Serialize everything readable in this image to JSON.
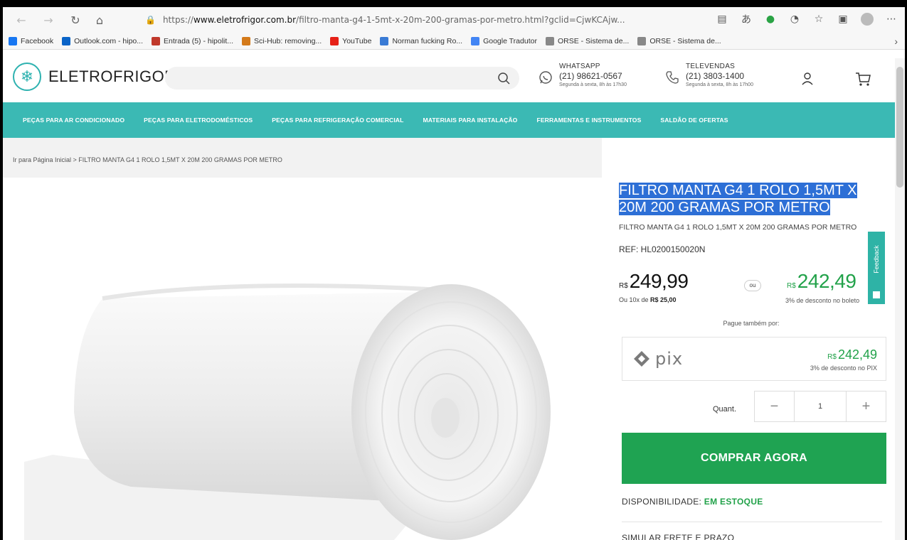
{
  "browser": {
    "url_prefix": "https://",
    "url_host": "www.eletrofrigor.com.br",
    "url_path": "/filtro-manta-g4-1-5mt-x-20m-200-gramas-por-metro.html?gclid=CjwKCAjw...",
    "bookmarks": [
      "Facebook",
      "Outlook.com - hipo...",
      "Entrada (5) - hipolit...",
      "Sci-Hub: removing...",
      "YouTube",
      "Norman fucking Ro...",
      "Google Tradutor",
      "ORSE - Sistema de...",
      "ORSE - Sistema de..."
    ],
    "bookmark_colors": [
      "#1877f2",
      "#0a64c8",
      "#c0392b",
      "#d47a1a",
      "#e62117",
      "#3a7bd5",
      "#4285f4",
      "#888888",
      "#888888"
    ]
  },
  "header": {
    "logo_text": "ELETROFRIGOR",
    "whatsapp": {
      "title": "WHATSAPP",
      "phone": "(21) 98621-0567",
      "hours": "Segunda à sexta, 8h às 17h30"
    },
    "televendas": {
      "title": "TELEVENDAS",
      "phone": "(21) 3803-1400",
      "hours": "Segunda à sexta, 8h às 17h00"
    }
  },
  "categories": [
    "PEÇAS PARA AR CONDICIONADO",
    "PEÇAS PARA ELETRODOMÉSTICOS",
    "PEÇAS PARA REFRIGERAÇÃO COMERCIAL",
    "MATERIAIS PARA INSTALAÇÃO",
    "FERRAMENTAS E INSTRUMENTOS",
    "SALDÃO DE OFERTAS"
  ],
  "breadcrumb": "Ir para Página Inicial  >  FILTRO MANTA G4 1 ROLO 1,5MT X 20M 200 GRAMAS POR METRO",
  "product": {
    "title": "FILTRO MANTA G4 1 ROLO 1,5MT X 20M 200 GRAMAS POR METRO",
    "subtitle": "FILTRO MANTA G4 1 ROLO 1,5MT X 20M 200 GRAMAS POR METRO",
    "ref": "REF: HL0200150020N",
    "currency": "R$",
    "price": "249,99",
    "installments_prefix": "Ou 10x de ",
    "installments_value": "R$ 25,00",
    "or": "ou",
    "boleto_price": "242,49",
    "boleto_note": "3% de desconto no boleto",
    "pague_tambem": "Pague também por:",
    "pix_label": "pix",
    "pix_price": "242,49",
    "pix_note": "3% de desconto no PIX",
    "qty_label": "Quant.",
    "qty_value": "1",
    "buy_label": "COMPRAR AGORA",
    "availability_label": "DISPONIBILIDADE: ",
    "availability_value": "EM ESTOQUE",
    "shipping": "SIMULAR FRETE E PRAZO"
  },
  "feedback_label": "Feedback"
}
